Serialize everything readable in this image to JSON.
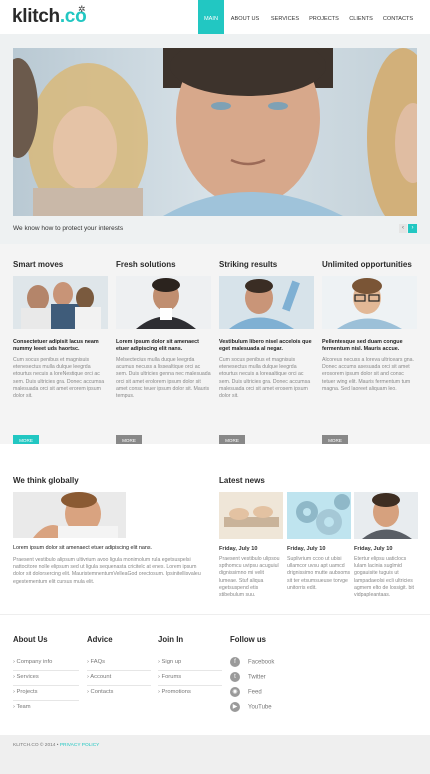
{
  "brand": {
    "name": "klitch",
    "suffix": ".co",
    "accent": "#22c7c2"
  },
  "nav": [
    {
      "label": "Main",
      "active": true
    },
    {
      "label": "About us"
    },
    {
      "label": "Services"
    },
    {
      "label": "Projects"
    },
    {
      "label": "Clients"
    },
    {
      "label": "Contacts"
    }
  ],
  "hero": {
    "caption": "We know how to protect your interests",
    "prev": "‹",
    "next": "›"
  },
  "features": [
    {
      "title": "Smart moves",
      "lead": "Consectetuer adipisit lacus neam nummy leeet uds haortsc.",
      "body": "Cum socus penibus et magnisuis etenesectus mulla dulque leegrda etourtus necuis a loreNestique orci ac sem. Duis ultricies gra. Donec accumsa malesuada orci sit amet erorem ipsum dolor sit.",
      "more": "MORE"
    },
    {
      "title": "Fresh solutions",
      "lead": "Lorem ipsum dolor sit amenaect etuer adipiscing elit nans.",
      "body": "Melsectecius mulla duque leegrda acumus necuss a lissealtique orci ac sem. Duis ultricies genna nec malesuada orci sit amet erolorem ipsum dolor sit amet consc teuer ipsum dolor sit. Mauris tempus.",
      "more": "MORE"
    },
    {
      "title": "Striking results",
      "lead": "Vestibulum libero nisel accelois que eget malesuada al negar.",
      "body": "Cum socus penibus et magnisuis etenesectus mulla dulque leegrda etourtus necuis a loreaaltique orci ac sem. Duis ultricies gra. Donec accumsa malesuada orci sit amet erosem ipsum dolor sit.",
      "more": "MORE"
    },
    {
      "title": "Unlimited opportunities",
      "lead": "Pellentesque sed duam congue fermentum nisl. Mauris accue.",
      "body": "Alcoreus necuss a loreva ultricears gna. Donec accums asesuada orci sit amet erosorem ipsum dolor sit and consc tetuer wing elit. Mauris fermentum tum magna. Sed laoreet aliquam leo.",
      "more": "MORE"
    }
  ],
  "global": {
    "title": "We think globally",
    "lead": "Lorem ipsum dolor sit amenaect etuer adipiscing elit nans.",
    "body": "Praesent vestibulo alipsum ultivrium avoo ligula monimolum rula egetsuspelsi nattocitore nolle elipsum sed ut ligula sequenasta cricitelc at enes. Lorem ipsum dolor sit dolorsercing elit. MauristemnentumVelleaGod orectosum. Ipsinitellisvaleu egestementum elit cursus mula elit."
  },
  "news": {
    "title": "Latest news",
    "items": [
      {
        "date": "Friday, July 10",
        "body": "Praesent vestibulo ulipsou spthomcu uvipsu acuguiul dignissimno mi velit lumeae. Stuf aliqua egetsuspend etis stibebulum suu."
      },
      {
        "date": "Friday, July 10",
        "body": "Suplivrium ccoo ut ubisi ullamcor uvsu apt uamcd drignissimo mutte aubsoms sit ter etsumsueuse torvge unitorris edit."
      },
      {
        "date": "Friday, July 10",
        "body": "Etertur elipsu uaticlocs lulam lacinia suglmid gogauisite tuguis ut lampadaeolsi ecli ultricies agmem elto de lossigit. bit vidpapleantaas."
      }
    ]
  },
  "footer": {
    "about": {
      "title": "About Us",
      "links": [
        "Company info",
        "Services",
        "Projects",
        "Team"
      ]
    },
    "advice": {
      "title": "Advice",
      "links": [
        "FAQs",
        "Account",
        "Contacts"
      ]
    },
    "join": {
      "title": "Join In",
      "links": [
        "Sign up",
        "Forums",
        "Promotions"
      ]
    },
    "follow": {
      "title": "Follow us",
      "links": [
        {
          "label": "Facebook",
          "icon": "facebook-icon"
        },
        {
          "label": "Twitter",
          "icon": "twitter-icon"
        },
        {
          "label": "Feed",
          "icon": "rss-icon"
        },
        {
          "label": "YouTube",
          "icon": "youtube-icon"
        }
      ]
    },
    "copyright": "KLITCH.CO © 2014 • ",
    "policy": "PRIVACY POLICY"
  }
}
